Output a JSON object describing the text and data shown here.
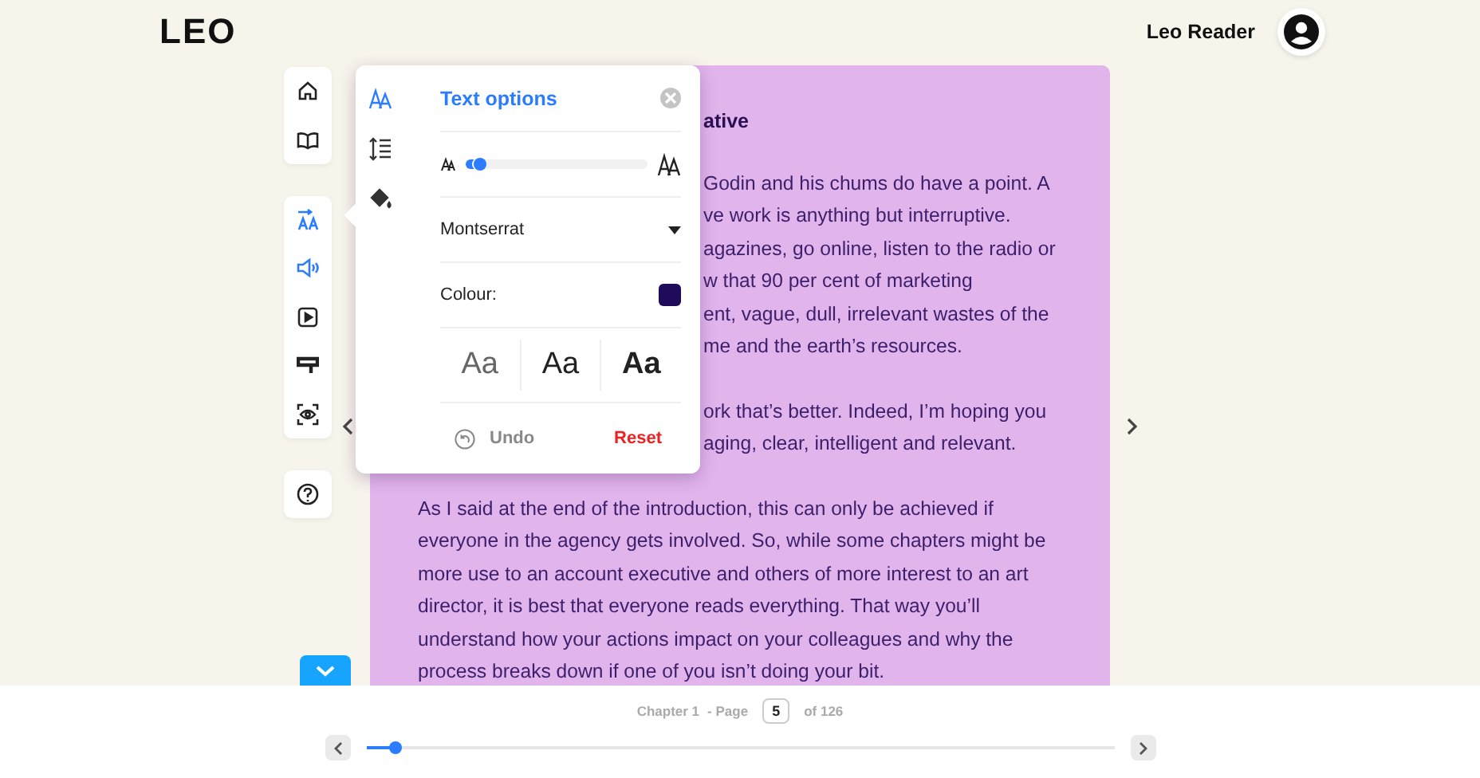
{
  "header": {
    "logo": "LEO",
    "user_name": "Leo Reader"
  },
  "toolbar": {
    "groups": [
      {
        "items": [
          {
            "kind": "home",
            "selected": false
          },
          {
            "kind": "book",
            "selected": false
          }
        ]
      },
      {
        "items": [
          {
            "kind": "text",
            "selected": true
          },
          {
            "kind": "audio",
            "selected": true
          },
          {
            "kind": "play",
            "selected": false
          },
          {
            "kind": "highlighter",
            "selected": false
          },
          {
            "kind": "focus",
            "selected": false
          }
        ]
      },
      {
        "items": [
          {
            "kind": "help",
            "selected": false
          }
        ]
      }
    ]
  },
  "popup": {
    "title": "Text options",
    "tabs": [
      {
        "kind": "text-size",
        "selected": true
      },
      {
        "kind": "line-spacing",
        "selected": false
      },
      {
        "kind": "colour",
        "selected": false
      }
    ],
    "size_slider": {
      "level": 0.08
    },
    "font": "Montserrat",
    "colour_label": "Colour:",
    "swatch": {
      "color": "#1f0a5c"
    },
    "weights": [
      {
        "label": "Aa",
        "kind": "light"
      },
      {
        "label": "Aa",
        "kind": "regular"
      },
      {
        "label": "Aa",
        "kind": "bold"
      }
    ],
    "undo": "Undo",
    "reset": "Reset"
  },
  "page": {
    "heading": "ative",
    "covered_paragraphs": [
      {
        "lines": [
          "Godin and his chums do have a point. A",
          "ve work is anything but interruptive.",
          "agazines, go online, listen to the radio or",
          "w that 90 per cent of marketing",
          "ent, vague, dull, irrelevant wastes of the",
          "me and the earth’s resources."
        ]
      },
      {
        "lines": [
          "ork that’s better. Indeed, I’m hoping you",
          "aging, clear, intelligent and relevant."
        ]
      }
    ],
    "paragraph": "As I said at the end of the introduction, this can only be achieved if everyone in the agency gets involved. So, while some chapters might be more use to an account executive and others of more interest to an art director, it is best that everyone reads everything. That way you’ll understand how your actions impact on your colleagues and why the process breaks down if one of you isn’t doing your bit."
  },
  "footer": {
    "chapter": "Chapter 1",
    "page_label": "- Page",
    "page": "5",
    "total": "of 126",
    "slider": {
      "level": 0.04
    }
  }
}
